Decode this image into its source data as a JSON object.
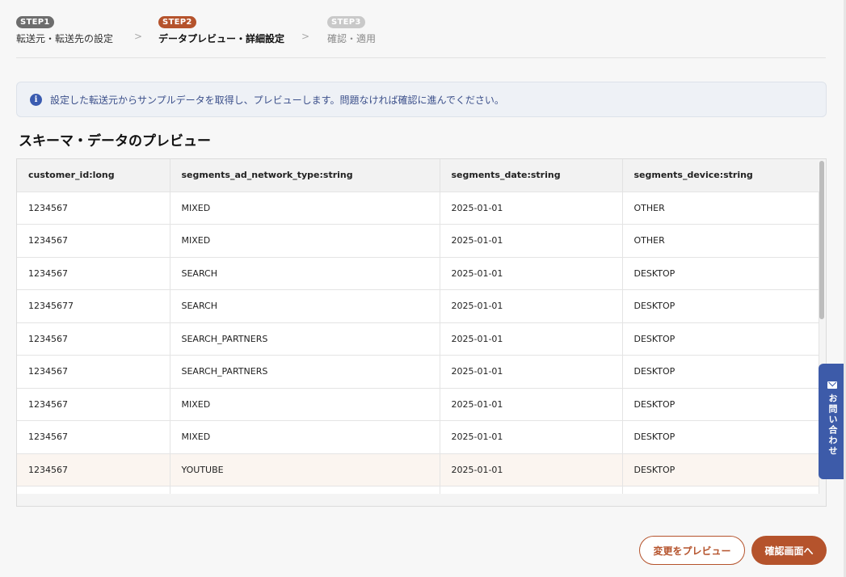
{
  "steps": [
    {
      "badge": "STEP1",
      "label": "転送元・転送先の設定",
      "state": "done"
    },
    {
      "badge": "STEP2",
      "label": "データプレビュー・詳細設定",
      "state": "active"
    },
    {
      "badge": "STEP3",
      "label": "確認・適用",
      "state": "todo"
    }
  ],
  "chevron": ">",
  "info": {
    "icon": "info-icon",
    "icon_glyph": "i",
    "text": "設定した転送元からサンプルデータを取得し、プレビューします。問題なければ確認に進んでください。"
  },
  "section_title": "スキーマ・データのプレビュー",
  "table": {
    "columns": [
      "customer_id:long",
      "segments_ad_network_type:string",
      "segments_date:string",
      "segments_device:string"
    ],
    "rows": [
      [
        "1234567",
        "MIXED",
        "2025-01-01",
        "OTHER"
      ],
      [
        "1234567",
        "MIXED",
        "2025-01-01",
        "OTHER"
      ],
      [
        "1234567",
        "SEARCH",
        "2025-01-01",
        "DESKTOP"
      ],
      [
        "12345677",
        "SEARCH",
        "2025-01-01",
        "DESKTOP"
      ],
      [
        "1234567",
        "SEARCH_PARTNERS",
        "2025-01-01",
        "DESKTOP"
      ],
      [
        "1234567",
        "SEARCH_PARTNERS",
        "2025-01-01",
        "DESKTOP"
      ],
      [
        "1234567",
        "MIXED",
        "2025-01-01",
        "DESKTOP"
      ],
      [
        "1234567",
        "MIXED",
        "2025-01-01",
        "DESKTOP"
      ],
      [
        "1234567",
        "YOUTUBE",
        "2025-01-01",
        "DESKTOP"
      ]
    ]
  },
  "buttons": {
    "preview_changes": "変更をプレビュー",
    "to_confirm": "確認画面へ"
  },
  "contact": {
    "icon": "mail-icon",
    "label": "お問い合わせ"
  },
  "colors": {
    "accent": "#b5532c",
    "contact_bg": "#3d5ba9",
    "info_text": "#3b4f8a"
  }
}
